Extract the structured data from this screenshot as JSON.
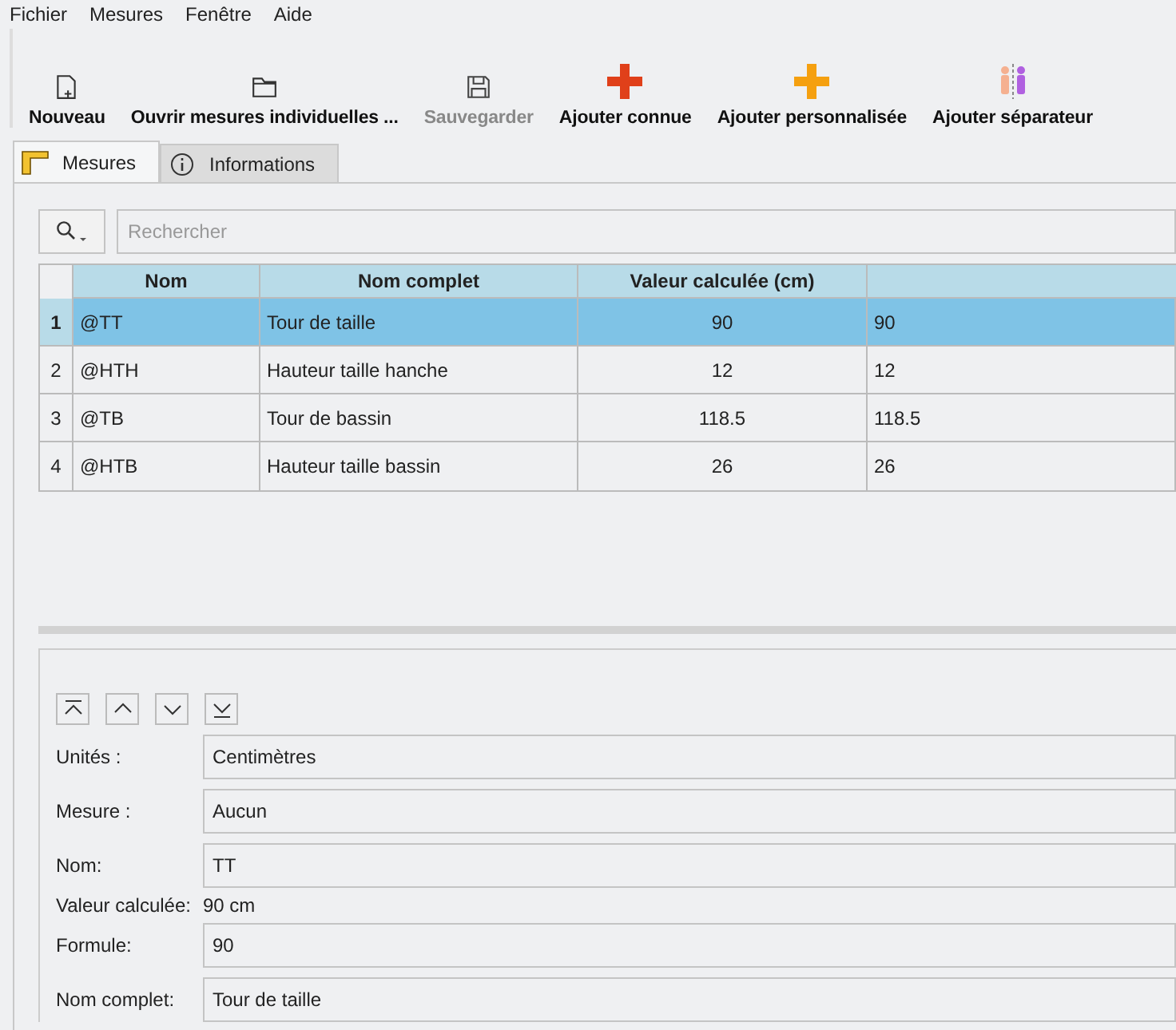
{
  "menu": [
    "Fichier",
    "Mesures",
    "Fenêtre",
    "Aide"
  ],
  "toolbar": [
    {
      "label": "Nouveau",
      "disabled": false
    },
    {
      "label": "Ouvrir mesures individuelles ...",
      "disabled": false
    },
    {
      "label": "Sauvegarder",
      "disabled": true
    },
    {
      "label": "Ajouter connue",
      "disabled": false
    },
    {
      "label": "Ajouter personnalisée",
      "disabled": false
    },
    {
      "label": "Ajouter séparateur",
      "disabled": false
    }
  ],
  "tabs": [
    {
      "label": "Mesures",
      "selected": true
    },
    {
      "label": "Informations",
      "selected": false
    }
  ],
  "search": {
    "placeholder": "Rechercher"
  },
  "table": {
    "columns": [
      "Nom",
      "Nom complet",
      "Valeur calculée (cm)"
    ],
    "rows": [
      {
        "index": "1",
        "cells": [
          "@TT",
          "Tour de taille",
          "90",
          "90"
        ],
        "selected": true
      },
      {
        "index": "2",
        "cells": [
          "@HTH",
          "Hauteur taille hanche",
          "12",
          "12"
        ],
        "selected": false
      },
      {
        "index": "3",
        "cells": [
          "@TB",
          "Tour de bassin",
          "118.5",
          "118.5"
        ],
        "selected": false
      },
      {
        "index": "4",
        "cells": [
          "@HTB",
          "Hauteur taille bassin",
          "26",
          "26"
        ],
        "selected": false
      }
    ]
  },
  "details": [
    {
      "kind": "field",
      "label": "Unités :",
      "value": "Centimètres"
    },
    {
      "kind": "field",
      "label": "Mesure :",
      "value": "Aucun"
    },
    {
      "kind": "field",
      "label": "Nom:",
      "value": "TT"
    },
    {
      "kind": "text",
      "label": "Valeur calculée:",
      "value": "90 cm"
    },
    {
      "kind": "field",
      "label": "Formule:",
      "value": "90"
    },
    {
      "kind": "field",
      "label": "Nom complet:",
      "value": "Tour de taille"
    }
  ]
}
